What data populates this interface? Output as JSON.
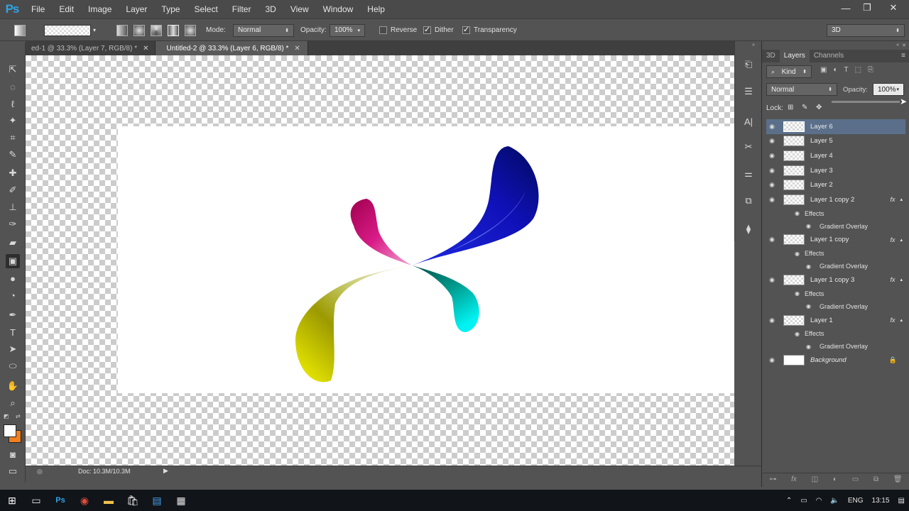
{
  "app": {
    "logo": "Ps"
  },
  "menu": [
    "File",
    "Edit",
    "Image",
    "Layer",
    "Type",
    "Select",
    "Filter",
    "3D",
    "View",
    "Window",
    "Help"
  ],
  "window_controls": {
    "minimize": "—",
    "restore": "❐",
    "close": "✕"
  },
  "options": {
    "mode_label": "Mode:",
    "mode_value": "Normal",
    "opacity_label": "Opacity:",
    "opacity_value": "100%",
    "reverse_label": "Reverse",
    "dither_label": "Dither",
    "transparency_label": "Transparency",
    "workspace_value": "3D",
    "reverse_checked": false,
    "dither_checked": true,
    "transparency_checked": true
  },
  "tabs": [
    {
      "label": "ed-1 @ 33.3% (Layer 7, RGB/8) *",
      "active": false
    },
    {
      "label": "Untitled-2 @ 33.3% (Layer 6, RGB/8) *",
      "active": true
    }
  ],
  "status": {
    "doc": "Doc: 10.3M/10.3M"
  },
  "panel": {
    "tabs": [
      "3D",
      "Layers",
      "Channels"
    ],
    "active_tab": "Layers",
    "filter_value": "Kind",
    "blend_value": "Normal",
    "opacity_label": "Opacity:",
    "opacity_value": "100%",
    "lock_label": "Lock:"
  },
  "layers": [
    {
      "name": "Layer 6",
      "selected": true
    },
    {
      "name": "Layer 5"
    },
    {
      "name": "Layer 4"
    },
    {
      "name": "Layer 3"
    },
    {
      "name": "Layer 2"
    },
    {
      "name": "Layer 1 copy 2",
      "fx": true,
      "effects_label": "Effects",
      "effect": "Gradient Overlay"
    },
    {
      "name": "Layer 1 copy",
      "fx": true,
      "effects_label": "Effects",
      "effect": "Gradient Overlay"
    },
    {
      "name": "Layer 1 copy 3",
      "fx": true,
      "effects_label": "Effects",
      "effect": "Gradient Overlay"
    },
    {
      "name": "Layer 1",
      "fx": true,
      "effects_label": "Effects",
      "effect": "Gradient Overlay"
    },
    {
      "name": "Background",
      "locked": true,
      "italic": true
    }
  ],
  "taskbar": {
    "lang": "ENG",
    "time": "13:15"
  },
  "colors": {
    "foreground": "#ffffff",
    "background": "#f07f1e",
    "selection": "#5b6f8a"
  }
}
